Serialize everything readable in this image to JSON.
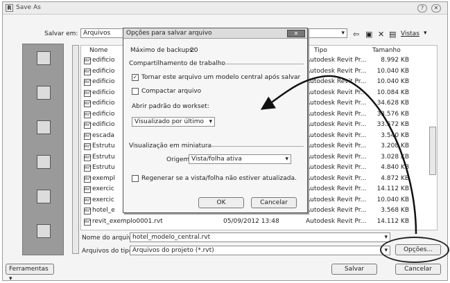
{
  "window": {
    "title": "Save As",
    "icon": "R"
  },
  "save_in": {
    "label": "Salvar em:",
    "value": "Arquivos"
  },
  "toolbar": {
    "views_label": "Vistas"
  },
  "places": [
    {
      "label": "",
      "icon": "recent-icon"
    },
    {
      "label": "",
      "icon": "desktop-icon"
    },
    {
      "label": "",
      "icon": "documents-icon"
    },
    {
      "label": "",
      "icon": "computer-icon"
    },
    {
      "label": "",
      "icon": "network-icon"
    },
    {
      "label": "",
      "icon": "favorites-icon"
    }
  ],
  "columns": {
    "name": "Nome",
    "type": "Tipo",
    "size": "Tamanho"
  },
  "files": [
    {
      "name": "edificio",
      "date": "",
      "type": "Autodesk Revit Pr...",
      "size": "8.992 KB"
    },
    {
      "name": "edificio",
      "date": "",
      "type": "Autodesk Revit Pr...",
      "size": "10.040 KB"
    },
    {
      "name": "edificio",
      "date": "",
      "type": "Autodesk Revit Pr...",
      "size": "10.040 KB"
    },
    {
      "name": "edificio",
      "date": "",
      "type": "Autodesk Revit Pr...",
      "size": "10.084 KB"
    },
    {
      "name": "edificio",
      "date": "",
      "type": "Autodesk Revit Pr...",
      "size": "34.628 KB"
    },
    {
      "name": "edificio",
      "date": "",
      "type": "Autodesk Revit Pr...",
      "size": "33.576 KB"
    },
    {
      "name": "edificio",
      "date": "",
      "type": "Autodesk Revit Pr...",
      "size": "33.572 KB"
    },
    {
      "name": "escada",
      "date": "",
      "type": "Autodesk Revit Pr...",
      "size": "3.540 KB"
    },
    {
      "name": "Estrutu",
      "date": "",
      "type": "Autodesk Revit Pr...",
      "size": "3.208 KB"
    },
    {
      "name": "Estrutu",
      "date": "",
      "type": "Autodesk Revit Pr...",
      "size": "3.028 KB"
    },
    {
      "name": "Estrutu",
      "date": "",
      "type": "Autodesk Revit Pr...",
      "size": "4.840 KB"
    },
    {
      "name": "exempl",
      "date": "",
      "type": "Autodesk Revit Pr...",
      "size": "4.872 KB"
    },
    {
      "name": "exercic",
      "date": "",
      "type": "Autodesk Revit Pr...",
      "size": "14.112 KB"
    },
    {
      "name": "exercic",
      "date": "",
      "type": "Autodesk Revit Pr...",
      "size": "10.040 KB"
    },
    {
      "name": "hotel_e",
      "date": "",
      "type": "Autodesk Revit Pr...",
      "size": "3.568 KB"
    },
    {
      "name": "revit_exemplo0001.rvt",
      "date": "05/09/2012 13:48",
      "type": "Autodesk Revit Pr...",
      "size": "14.112 KB"
    }
  ],
  "filename": {
    "label": "Nome do arquivo:",
    "value": "hotel_modelo_central.rvt"
  },
  "filetype": {
    "label": "Arquivos do tipo:",
    "value": "Arquivos do projeto  (*.rvt)"
  },
  "buttons": {
    "tools": "Ferramentas",
    "options": "Opções...",
    "save": "Salvar",
    "cancel": "Cancelar"
  },
  "dialog": {
    "title": "Opções para salvar arquivo",
    "max_backups_label": "Máximo de backups:",
    "max_backups_value": "20",
    "worksharing_title": "Compartilhamento de trabalho",
    "make_central_label": "Tornar este arquivo um modelo central após salvar",
    "make_central_checked": true,
    "compact_label": "Compactar arquivo",
    "compact_checked": false,
    "open_workset_label": "Abrir padrão do workset:",
    "open_workset_value": "Visualizado por último",
    "thumbnail_title": "Visualização em miniatura",
    "source_label": "Origem:",
    "source_value": "Vista/folha ativa",
    "regen_label": "Regenerar se a vista/folha não estiver atualizada.",
    "regen_checked": false,
    "ok": "OK",
    "cancel": "Cancelar"
  },
  "annotation": {
    "arrow_color": "#111111",
    "oval_color": "#222222"
  }
}
